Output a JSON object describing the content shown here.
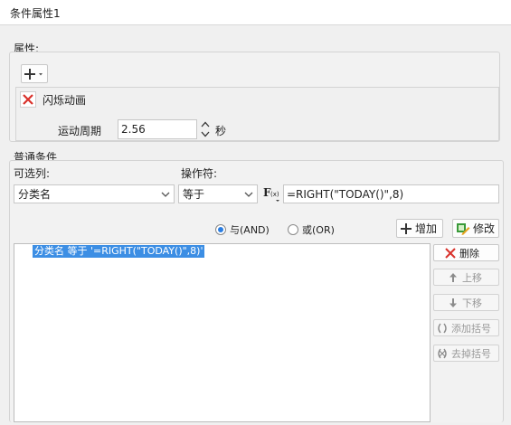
{
  "window": {
    "title": "条件属性1"
  },
  "attributes": {
    "group_label": "属性:",
    "effect_label": "闪烁动画",
    "period_label": "运动周期",
    "period_value": "2.56",
    "period_unit": "秒"
  },
  "conditions": {
    "group_label": "普通条件",
    "column_label": "可选列:",
    "column_value": "分类名",
    "operator_label": "操作符:",
    "operator_value": "等于",
    "formula_value": "=RIGHT(\"TODAY()\",8)",
    "radio_and": "与(AND)",
    "radio_or": "或(OR)",
    "add_label": "增加",
    "modify_label": "修改",
    "list_items": [
      "分类名 等于 '=RIGHT(\"TODAY()\",8)'"
    ],
    "delete_label": "删除",
    "move_up_label": "上移",
    "move_down_label": "下移",
    "add_bracket_label": "添加括号",
    "remove_bracket_label": "去掉括号"
  },
  "colors": {
    "selection": "#3c8ee4",
    "delete_red": "#d9312b",
    "radio_blue": "#2a7de1"
  }
}
